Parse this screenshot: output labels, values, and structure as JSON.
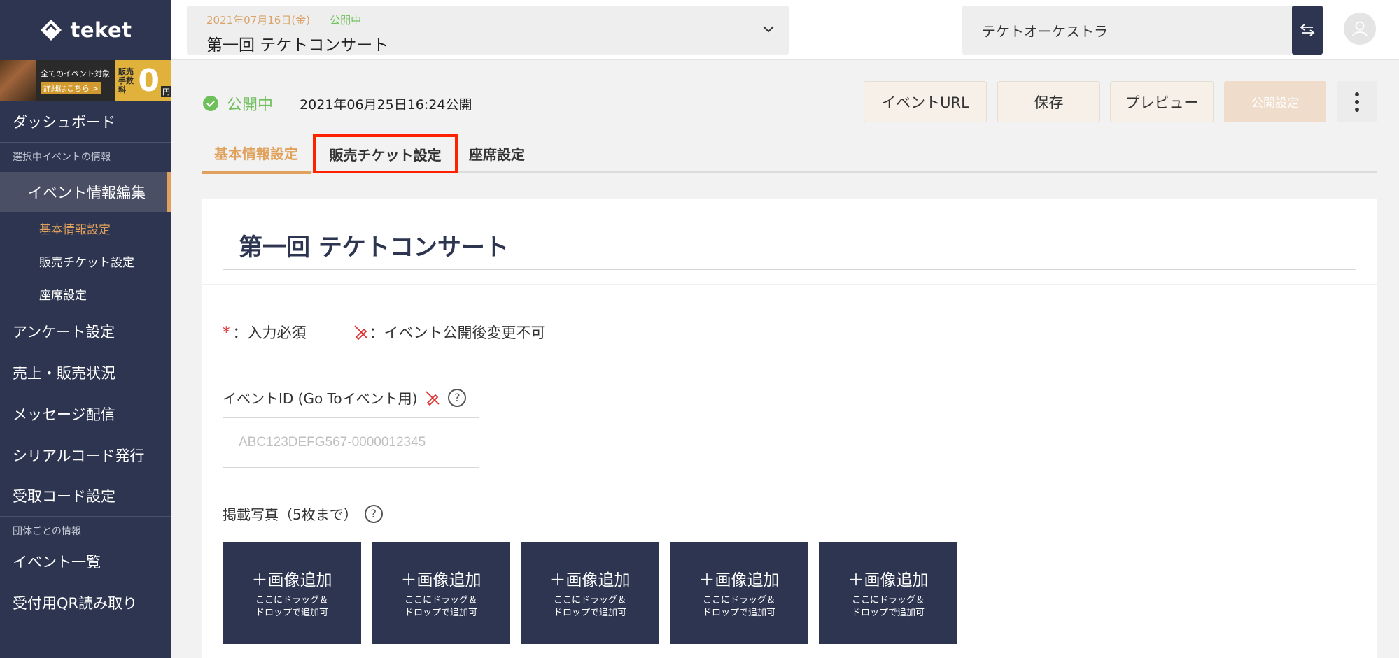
{
  "brand": {
    "name": "teket"
  },
  "banner": {
    "line1": "全てのイベント対象",
    "line2": "詳細はこちら >",
    "fee_label": "販売\n手数料",
    "fee_value": "0",
    "yen": "円"
  },
  "sidebar": {
    "dashboard": "ダッシュボード",
    "section_selected": "選択中イベントの情報",
    "event_edit": "イベント情報編集",
    "sub_items": [
      "基本情報設定",
      "販売チケット設定",
      "座席設定"
    ],
    "items_mid": [
      "アンケート設定",
      "売上・販売状況",
      "メッセージ配信",
      "シリアルコード発行",
      "受取コード設定"
    ],
    "section_org": "団体ごとの情報",
    "items_bottom": [
      "イベント一覧",
      "受付用QR読み取り"
    ]
  },
  "header": {
    "event_date": "2021年07月16日(金)",
    "event_status": "公開中",
    "event_name": "第一回 テケトコンサート",
    "org_name": "テケトオーケストラ"
  },
  "status": {
    "label": "公開中",
    "published_at": "2021年06月25日16:24公開"
  },
  "actions": {
    "event_url": "イベントURL",
    "save": "保存",
    "preview": "プレビュー",
    "publish_settings": "公開設定"
  },
  "tabs": [
    "基本情報設定",
    "販売チケット設定",
    "座席設定"
  ],
  "form": {
    "title": "第一回 テケトコンサート",
    "legend_required_mark": "*",
    "legend_required": "：入力必須",
    "legend_locked": "：イベント公開後変更不可",
    "event_id_label": "イベントID (Go Toイベント用)",
    "event_id_placeholder": "ABC123DEFG567-0000012345",
    "photos_label": "掲載写真（5枚まで）",
    "help_glyph": "?",
    "photo_add": "＋画像追加",
    "photo_hint_1": "ここにドラッグ＆",
    "photo_hint_2": "ドロップで追加可"
  },
  "colors": {
    "sidebar": "#2d3550",
    "accent": "#e0a15c",
    "published": "#6fbf5a",
    "highlight": "#ff2200"
  }
}
